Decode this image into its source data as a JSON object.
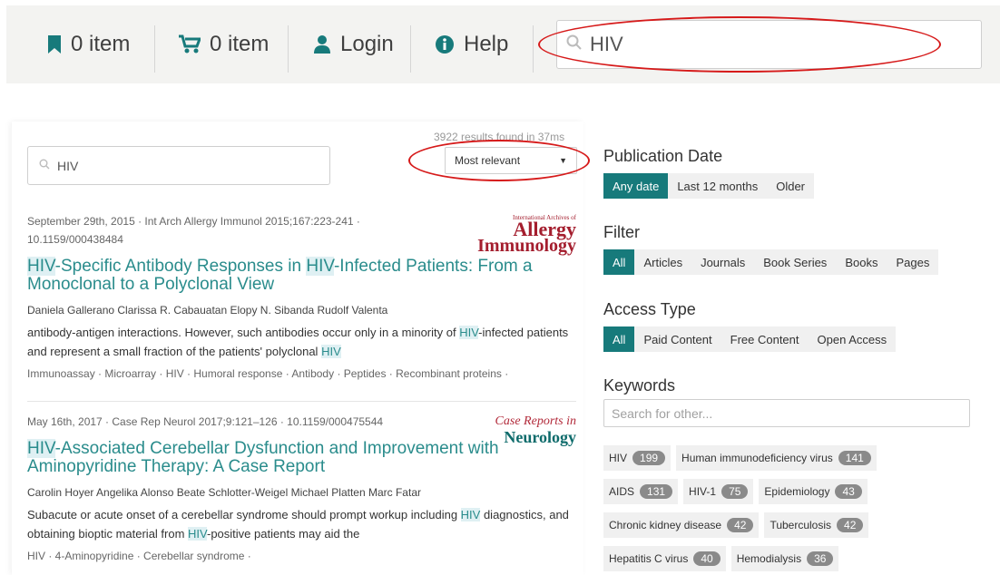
{
  "header": {
    "bookmarks": {
      "label": "0 item",
      "icon": "bookmark-icon"
    },
    "cart": {
      "label": "0 item",
      "icon": "cart-icon"
    },
    "login": {
      "label": "Login",
      "icon": "user-icon"
    },
    "help": {
      "label": "Help",
      "icon": "info-icon"
    },
    "search_value": "HIV"
  },
  "results": {
    "count_text": "3922 results found in 37ms",
    "search_value": "HIV",
    "sort_selected": "Most relevant",
    "items": [
      {
        "meta": "September 29th, 2015 · Int Arch Allergy Immunol 2015;167:223-241 · 10.1159/000438484",
        "title_hl1": "HIV",
        "title_mid": "-Specific Antibody Responses in ",
        "title_hl2": "HIV",
        "title_end": "-Infected Patients: From a Monoclonal to a Polyclonal View",
        "authors": "Daniela Gallerano Clarissa R. Cabauatan Elopy N. Sibanda Rudolf Valenta",
        "snip_a": "antibody-antigen interactions. However, such antibodies occur only in a minority of ",
        "snip_hl1": "HIV",
        "snip_b": "-infected patients and represent a small fraction of the patients' polyclonal ",
        "snip_hl2": "HIV",
        "snip_c": "",
        "keywords": "Immunoassay · Microarray · HIV · Humoral response · Antibody · Peptides · Recombinant proteins ·",
        "logo": {
          "top": "International Archives of",
          "mid": "Allergy",
          "bot": "Immunology"
        }
      },
      {
        "meta": "May 16th, 2017 · Case Rep Neurol 2017;9:121–126 · 10.1159/000475544",
        "title_hl1": "HIV",
        "title_mid": "-Associated Cerebellar Dysfunction and Improvement with Aminopyridine Therapy: A Case Report",
        "title_hl2": "",
        "title_end": "",
        "authors": "Carolin Hoyer Angelika Alonso Beate Schlotter-Weigel Michael Platten Marc Fatar",
        "snip_a": "Subacute or acute onset of a cerebellar syndrome should prompt workup including ",
        "snip_hl1": "HIV",
        "snip_b": " diagnostics, and obtaining bioptic material from ",
        "snip_hl2": "HIV",
        "snip_c": "-positive patients may aid the",
        "keywords": "HIV · 4-Aminopyridine · Cerebellar syndrome ·",
        "logo": {
          "top": "Case Reports in",
          "mid": "",
          "bot": "Neurology"
        }
      }
    ]
  },
  "filters": {
    "publication_date": {
      "title": "Publication Date",
      "options": [
        "Any date",
        "Last 12 months",
        "Older"
      ],
      "active": 0
    },
    "filter": {
      "title": "Filter",
      "options": [
        "All",
        "Articles",
        "Journals",
        "Book Series",
        "Books",
        "Pages"
      ],
      "active": 0
    },
    "access_type": {
      "title": "Access Type",
      "options": [
        "All",
        "Paid Content",
        "Free Content",
        "Open Access"
      ],
      "active": 0
    },
    "keywords": {
      "title": "Keywords",
      "placeholder": "Search for other...",
      "chips": [
        {
          "label": "HIV",
          "count": "199"
        },
        {
          "label": "Human immunodeficiency virus",
          "count": "141"
        },
        {
          "label": "AIDS",
          "count": "131"
        },
        {
          "label": "HIV-1",
          "count": "75"
        },
        {
          "label": "Epidemiology",
          "count": "43"
        },
        {
          "label": "Chronic kidney disease",
          "count": "42"
        },
        {
          "label": "Tuberculosis",
          "count": "42"
        },
        {
          "label": "Hepatitis C virus",
          "count": "40"
        },
        {
          "label": "Hemodialysis",
          "count": "36"
        }
      ]
    }
  },
  "colors": {
    "accent": "#177a7b",
    "link": "#2a8c8c",
    "annotation": "#d61a1a"
  }
}
